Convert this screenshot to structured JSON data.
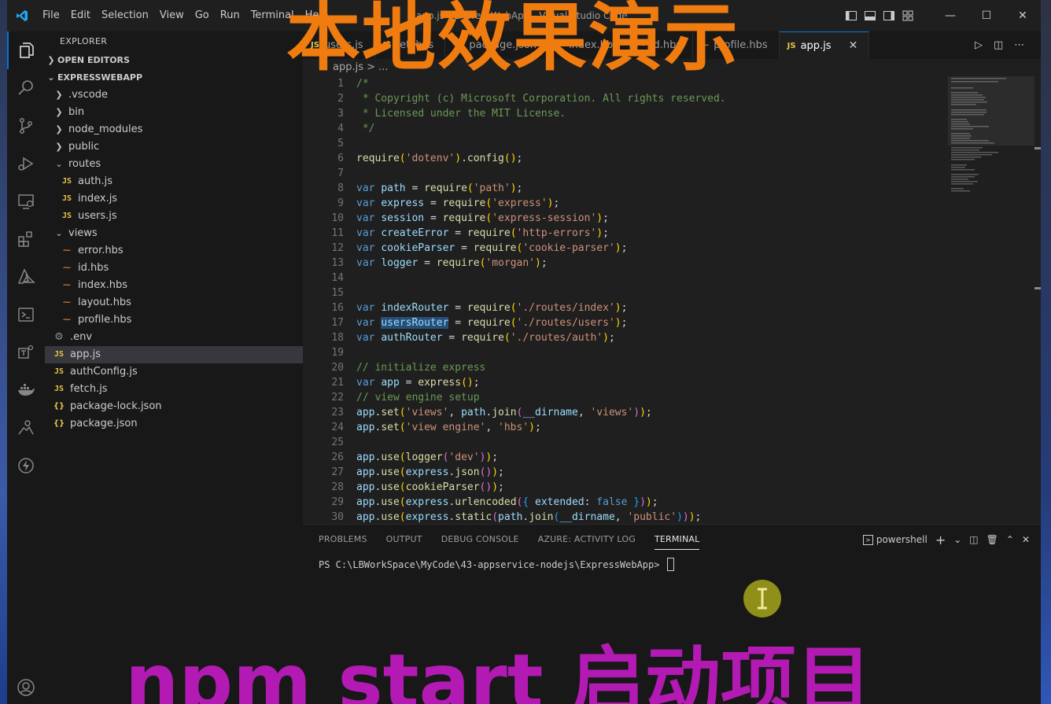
{
  "titlebar": {
    "menu": [
      "File",
      "Edit",
      "Selection",
      "View",
      "Go",
      "Run",
      "Terminal",
      "Help"
    ],
    "window_title": "app.js - ExpressWebApp - Visual Studio Code"
  },
  "overlays": {
    "top_caption": "本地效果演示",
    "bottom_caption": "npm start 启动项目"
  },
  "sidebar": {
    "title": "EXPLORER",
    "open_editors": "OPEN EDITORS",
    "project": "EXPRESSWEBAPP",
    "items": [
      {
        "label": ".vscode",
        "type": "folder",
        "depth": 1,
        "expanded": false
      },
      {
        "label": "bin",
        "type": "folder",
        "depth": 1,
        "expanded": false
      },
      {
        "label": "node_modules",
        "type": "folder",
        "depth": 1,
        "expanded": false
      },
      {
        "label": "public",
        "type": "folder",
        "depth": 1,
        "expanded": false
      },
      {
        "label": "routes",
        "type": "folder",
        "depth": 1,
        "expanded": true
      },
      {
        "label": "auth.js",
        "type": "js",
        "depth": 2
      },
      {
        "label": "index.js",
        "type": "js",
        "depth": 2
      },
      {
        "label": "users.js",
        "type": "js",
        "depth": 2
      },
      {
        "label": "views",
        "type": "folder",
        "depth": 1,
        "expanded": true
      },
      {
        "label": "error.hbs",
        "type": "hbs",
        "depth": 2
      },
      {
        "label": "id.hbs",
        "type": "hbs",
        "depth": 2
      },
      {
        "label": "index.hbs",
        "type": "hbs",
        "depth": 2
      },
      {
        "label": "layout.hbs",
        "type": "hbs",
        "depth": 2
      },
      {
        "label": "profile.hbs",
        "type": "hbs",
        "depth": 2
      },
      {
        "label": ".env",
        "type": "env",
        "depth": 1
      },
      {
        "label": "app.js",
        "type": "js",
        "depth": 1,
        "selected": true
      },
      {
        "label": "authConfig.js",
        "type": "js",
        "depth": 1
      },
      {
        "label": "fetch.js",
        "type": "js",
        "depth": 1
      },
      {
        "label": "package-lock.json",
        "type": "json",
        "depth": 1
      },
      {
        "label": "package.json",
        "type": "json",
        "depth": 1
      }
    ]
  },
  "tabs": [
    {
      "label": "users.js",
      "type": "js"
    },
    {
      "label": "fetch.js",
      "type": "js"
    },
    {
      "label": "package.json",
      "type": "json"
    },
    {
      "label": "index.hbs",
      "type": "hbs"
    },
    {
      "label": "id.hbs",
      "type": "hbs"
    },
    {
      "label": "profile.hbs",
      "type": "hbs"
    },
    {
      "label": "app.js",
      "type": "js",
      "active": true
    }
  ],
  "breadcrumb": "app.js > ...",
  "editor": {
    "lines": [
      "/*",
      " * Copyright (c) Microsoft Corporation. All rights reserved.",
      " * Licensed under the MIT License.",
      " */",
      "",
      "require('dotenv').config();",
      "",
      "var path = require('path');",
      "var express = require('express');",
      "var session = require('express-session');",
      "var createError = require('http-errors');",
      "var cookieParser = require('cookie-parser');",
      "var logger = require('morgan');",
      "",
      "",
      "var indexRouter = require('./routes/index');",
      "var usersRouter = require('./routes/users');",
      "var authRouter = require('./routes/auth');",
      "",
      "// initialize express",
      "var app = express();",
      "// view engine setup",
      "app.set('views', path.join(__dirname, 'views'));",
      "app.set('view engine', 'hbs');",
      "",
      "app.use(logger('dev'));",
      "app.use(express.json());",
      "app.use(cookieParser());",
      "app.use(express.urlencoded({ extended: false }));",
      "app.use(express.static(path.join(__dirname, 'public')));"
    ]
  },
  "panel": {
    "tabs": [
      "PROBLEMS",
      "OUTPUT",
      "DEBUG CONSOLE",
      "AZURE: ACTIVITY LOG",
      "TERMINAL"
    ],
    "active_tab": "TERMINAL",
    "shell": "powershell",
    "prompt": "PS C:\\LBWorkSpace\\MyCode\\43-appservice-nodejs\\ExpressWebApp> "
  }
}
